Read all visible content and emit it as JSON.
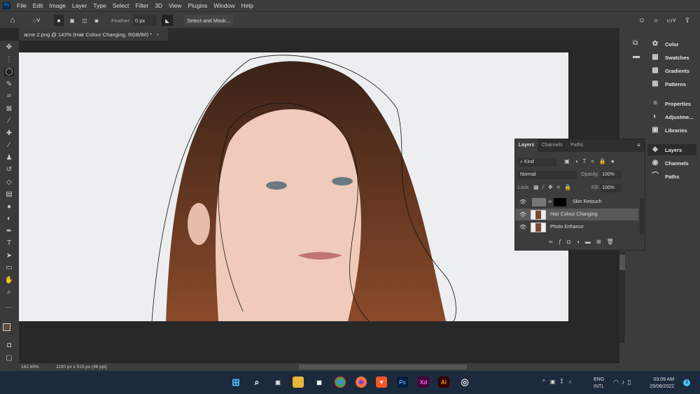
{
  "menu": [
    "File",
    "Edit",
    "Image",
    "Layer",
    "Type",
    "Select",
    "Filter",
    "3D",
    "View",
    "Plugins",
    "Window",
    "Help"
  ],
  "app_logo": "Ps",
  "options": {
    "feather_label": "Feather:",
    "feather_value": "0 px",
    "select_mask": "Select and Mask..."
  },
  "document_tab": "acne 2.png @ 143% (Hair Colour Changing, RGB/8#) *",
  "right_panels": [
    "Color",
    "Swatches",
    "Gradients",
    "Patterns",
    "Properties",
    "Adjustme...",
    "Libraries",
    "Layers",
    "Channels",
    "Paths"
  ],
  "layers_panel": {
    "tabs": [
      "Layers",
      "Channels",
      "Paths"
    ],
    "filter": "Kind",
    "blend_mode": "Normal",
    "opacity_label": "Opacity:",
    "opacity": "100%",
    "lock_label": "Lock:",
    "fill_label": "Fill:",
    "fill": "100%",
    "layers": [
      {
        "name": "Skin Retouch"
      },
      {
        "name": "Hair Colour Changing"
      },
      {
        "name": "Photo Enhance"
      }
    ]
  },
  "status": {
    "zoom": "142.65%",
    "size": "1100 px x 515 px (96 ppi)"
  },
  "taskbar": {
    "apps": [
      "Ps",
      "Xd",
      "Ai"
    ],
    "lang1": "ENG",
    "lang2": "INTL",
    "time": "03:09 AM",
    "date": "29/06/2022",
    "badge": "3"
  }
}
